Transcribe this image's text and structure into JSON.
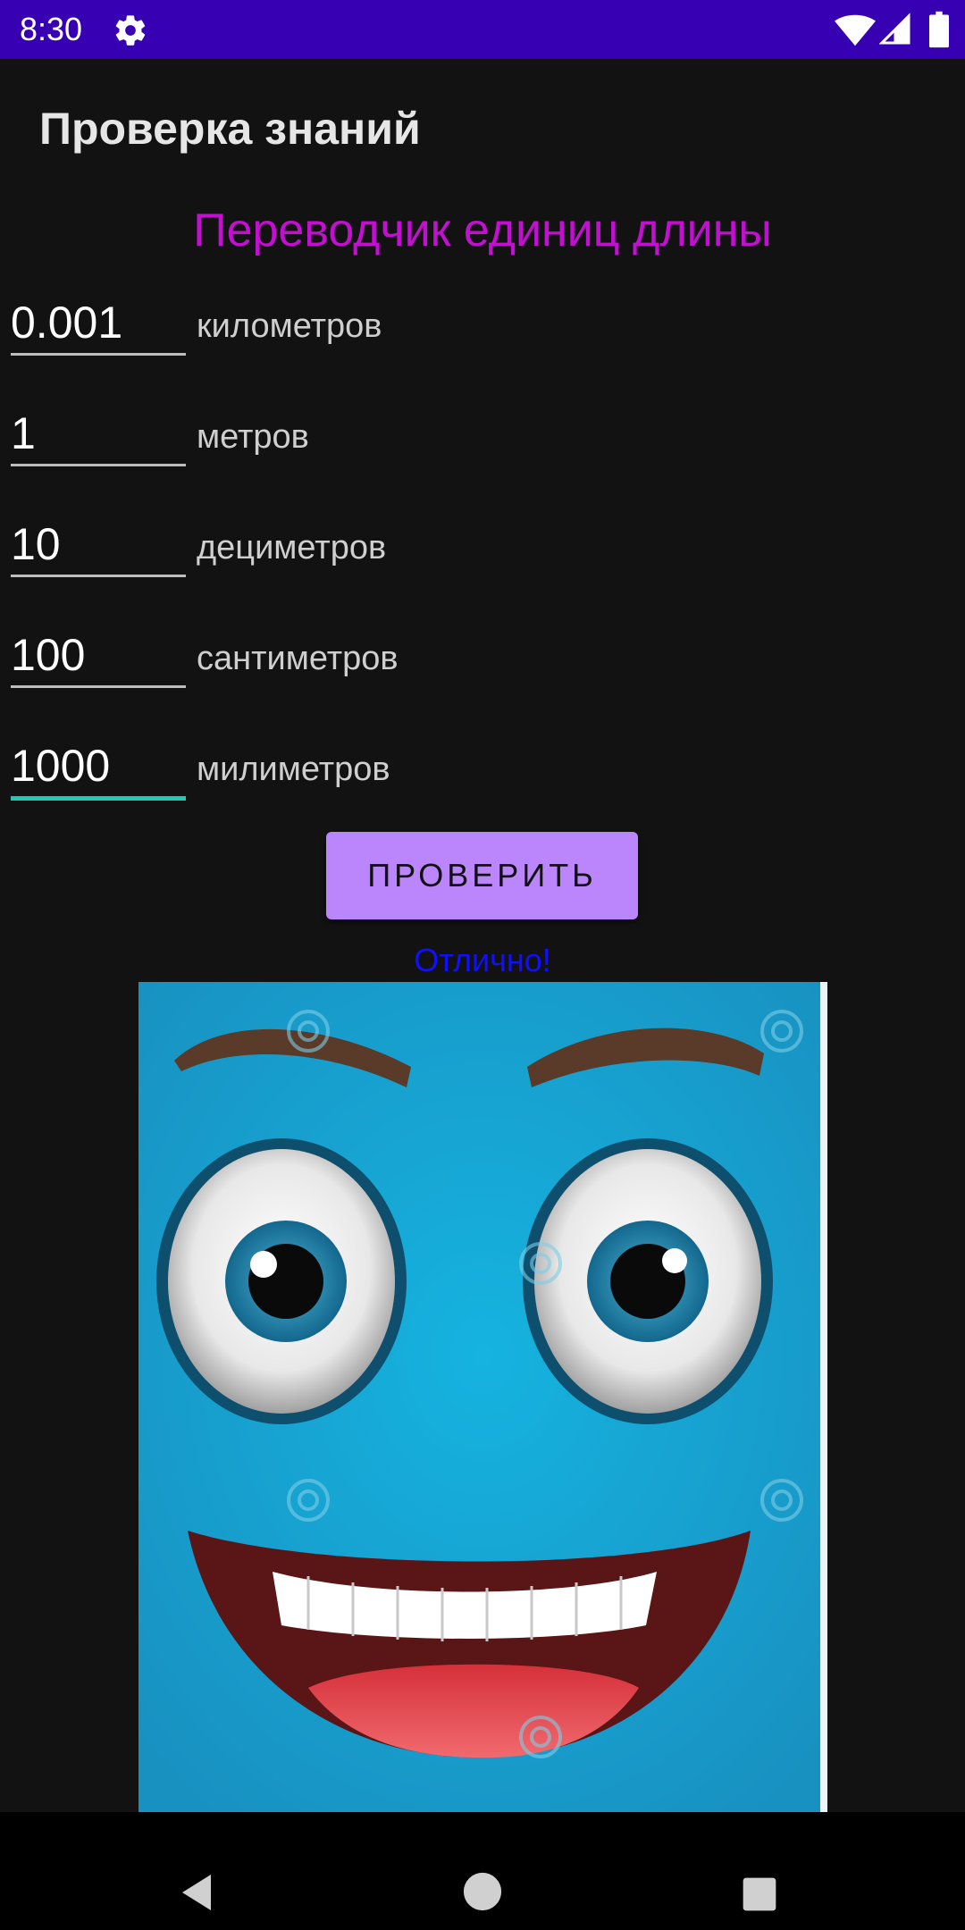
{
  "status_bar": {
    "time": "8:30",
    "icons": [
      "gear-icon",
      "wifi-icon",
      "signal-icon",
      "battery-icon"
    ],
    "background": "#3700B3"
  },
  "app_bar": {
    "title": "Проверка знаний"
  },
  "converter": {
    "title": "Переводчик единиц длины",
    "title_color": "#c20fd0",
    "rows": [
      {
        "value": "0.001",
        "unit": "километров"
      },
      {
        "value": "1",
        "unit": "метров"
      },
      {
        "value": "10",
        "unit": "дециметров"
      },
      {
        "value": "100",
        "unit": "сантиметров"
      },
      {
        "value": "1000",
        "unit": "милиметров"
      }
    ],
    "active_row_accent": "#1ec9b8"
  },
  "check_button": {
    "label": "ПРОВЕРИТЬ",
    "color": "#bb86fc"
  },
  "result": {
    "text": "Отлично!",
    "color": "#1010ff"
  },
  "image": {
    "name": "smiley-face-image",
    "background": "#1ba2d2"
  },
  "nav_bar": {
    "buttons": [
      "back-icon",
      "home-icon",
      "recents-icon"
    ]
  }
}
